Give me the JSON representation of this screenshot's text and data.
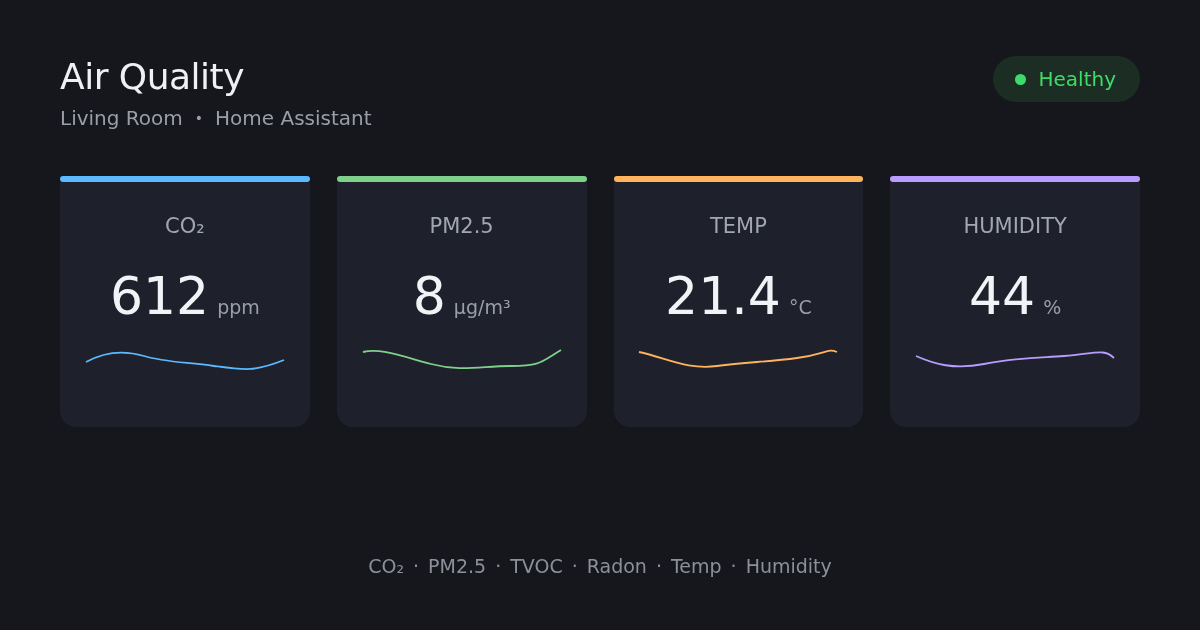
{
  "header": {
    "title": "Air Quality",
    "subtitle": [
      "Living Room",
      "Home Assistant"
    ],
    "separator": "•"
  },
  "status": {
    "label": "Healthy",
    "color": "#3ddc6a"
  },
  "cards": [
    {
      "label": "CO₂",
      "value": "612",
      "unit": "ppm",
      "color": "#5cb8ff"
    },
    {
      "label": "PM2.5",
      "value": "8",
      "unit": "µg/m³",
      "color": "#7fd08a"
    },
    {
      "label": "TEMP",
      "value": "21.4",
      "unit": "°C",
      "color": "#ffb35c"
    },
    {
      "label": "HUMIDITY",
      "value": "44",
      "unit": "%",
      "color": "#b89cff"
    }
  ],
  "footer": {
    "items": [
      "CO₂",
      "PM2.5",
      "TVOC",
      "Radon",
      "Temp",
      "Humidity"
    ],
    "separator": "·"
  }
}
